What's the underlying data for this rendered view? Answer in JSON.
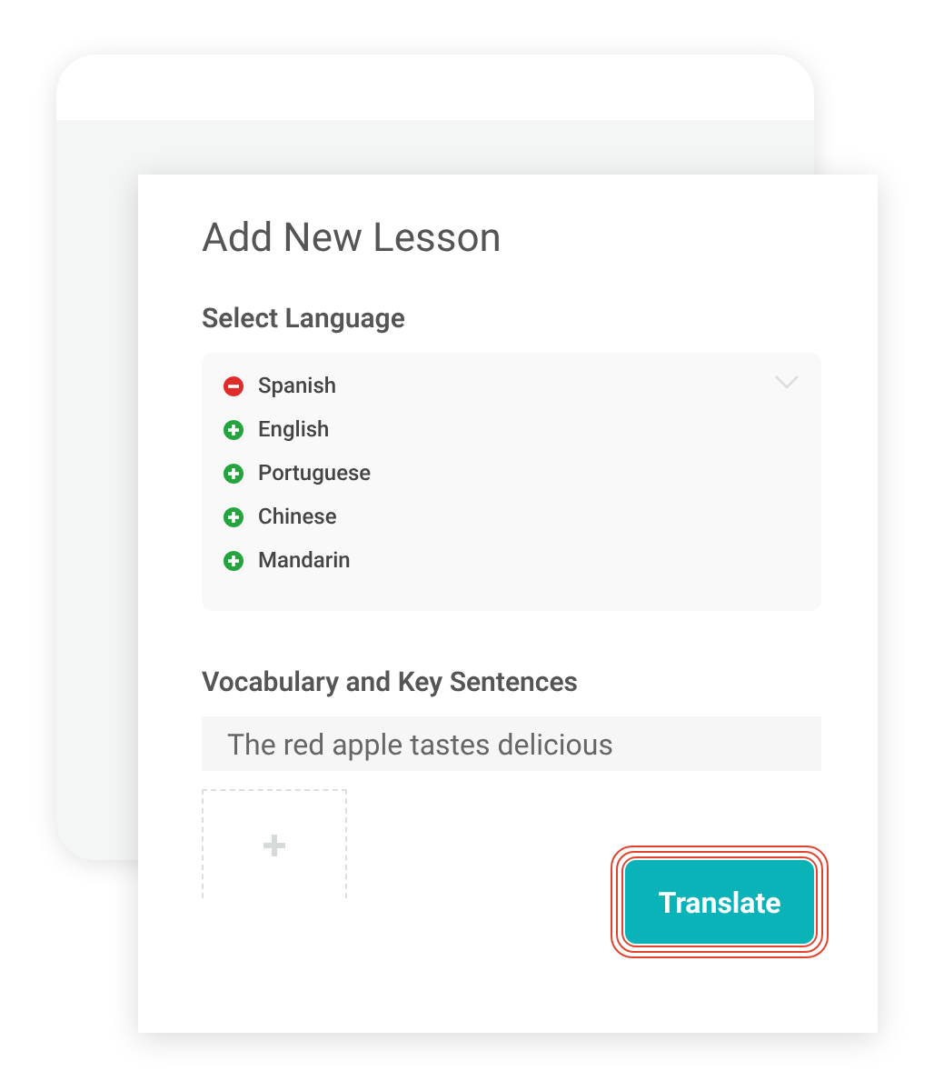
{
  "title": "Add New Lesson",
  "language_section": {
    "label": "Select Language",
    "languages": [
      {
        "name": "Spanish",
        "selected": true
      },
      {
        "name": "English",
        "selected": false
      },
      {
        "name": "Portuguese",
        "selected": false
      },
      {
        "name": "Chinese",
        "selected": false
      },
      {
        "name": "Mandarin",
        "selected": false
      }
    ]
  },
  "vocabulary_section": {
    "label": "Vocabulary and Key Sentences",
    "value": "The red apple tastes delicious"
  },
  "buttons": [
    {
      "label": "Translate",
      "focused": true
    }
  ]
}
